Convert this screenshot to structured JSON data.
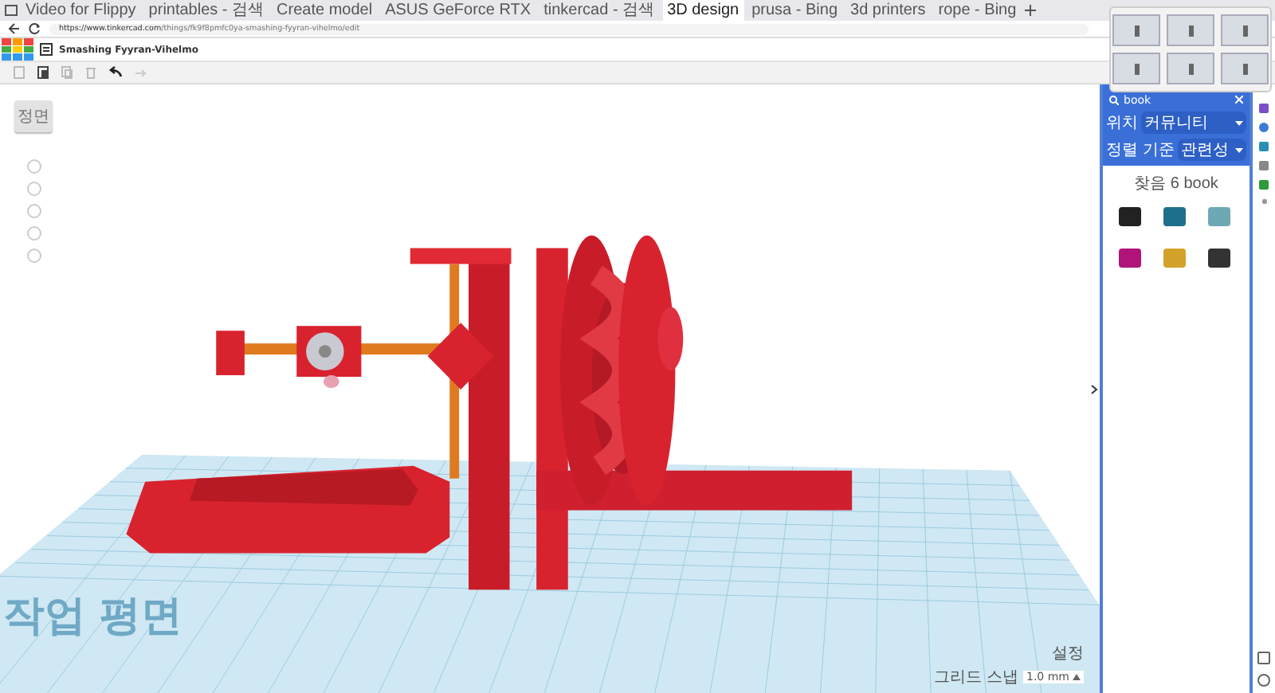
{
  "browser": {
    "tabs": [
      {
        "title": "Video for Flippy",
        "selected": false
      },
      {
        "title": "printables - 검색",
        "selected": false
      },
      {
        "title": "Create model",
        "selected": false
      },
      {
        "title": "ASUS GeForce RTX",
        "selected": false
      },
      {
        "title": "tinkercad - 검색",
        "selected": false
      },
      {
        "title": "3D design",
        "selected": true
      },
      {
        "title": "prusa - Bing",
        "selected": false
      },
      {
        "title": "3d printers",
        "selected": false
      },
      {
        "title": "rope - Bing",
        "selected": false
      }
    ],
    "url_host": "https://www.tinkercad.com",
    "url_path": "/things/fk9f8pmfc0ya-smashing-fyyran-vihelmo/edit"
  },
  "app": {
    "title": "Smashing Fyyran-Vihelmo",
    "view_cube_label": "정면"
  },
  "workplane_label": "작업 평면",
  "shapes_panel": {
    "search": "book",
    "filters": [
      {
        "label": "위치",
        "value": "커뮤니티"
      },
      {
        "label": "정렬 기준",
        "value": "관련성"
      }
    ],
    "results_heading": "찾음 6 book",
    "results": [
      {
        "color": "#222222"
      },
      {
        "color": "#1f6f8b"
      },
      {
        "color": "#6fa8b5"
      },
      {
        "color": "#b0137a"
      },
      {
        "color": "#d4a22a"
      },
      {
        "color": "#333333"
      }
    ]
  },
  "grid": {
    "settings": "설정",
    "snap_label": "그리드 스냅",
    "snap_value": "1.0 mm"
  }
}
